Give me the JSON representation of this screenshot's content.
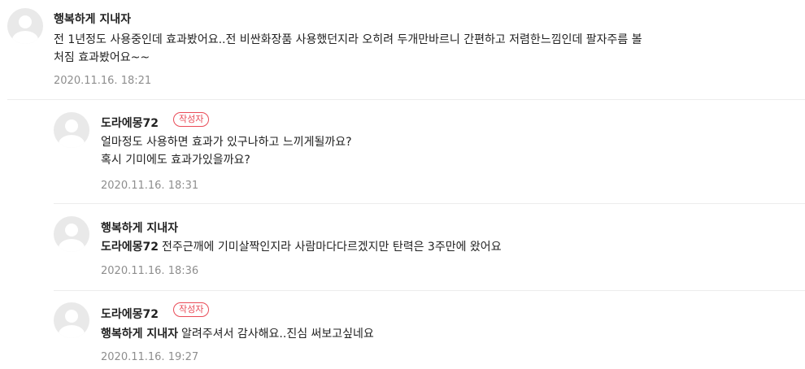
{
  "comments": [
    {
      "author": "행복하게 지내자",
      "text_line1": "전 1년정도 사용중인데 효과봤어요..전 비싼화장품 사용했던지라 오히려 두개만바르니 간편하고 저렴한느낌인데 팔자주름 볼",
      "text_line2": "처짐 효과봤어요~~",
      "date": "2020.11.16. 18:21"
    }
  ],
  "replies": [
    {
      "author": "도라에몽72",
      "badge": "작성자",
      "text_line1": "얼마정도 사용하면 효과가 있구나하고 느끼게될까요?",
      "text_line2": "혹시 기미에도 효과가있을까요?",
      "date": "2020.11.16. 18:31"
    },
    {
      "author": "행복하게 지내자",
      "mention": "도라에몽72",
      "text": "전주근깨에 기미살짝인지라 사람마다다르겠지만 탄력은 3주만에 왔어요",
      "date": "2020.11.16. 18:36"
    },
    {
      "author": "도라에몽72",
      "badge": "작성자",
      "mention": "행복하게 지내자",
      "text": "알려주셔서 감사해요..진심 써보고싶네요",
      "date": "2020.11.16. 19:27"
    }
  ]
}
